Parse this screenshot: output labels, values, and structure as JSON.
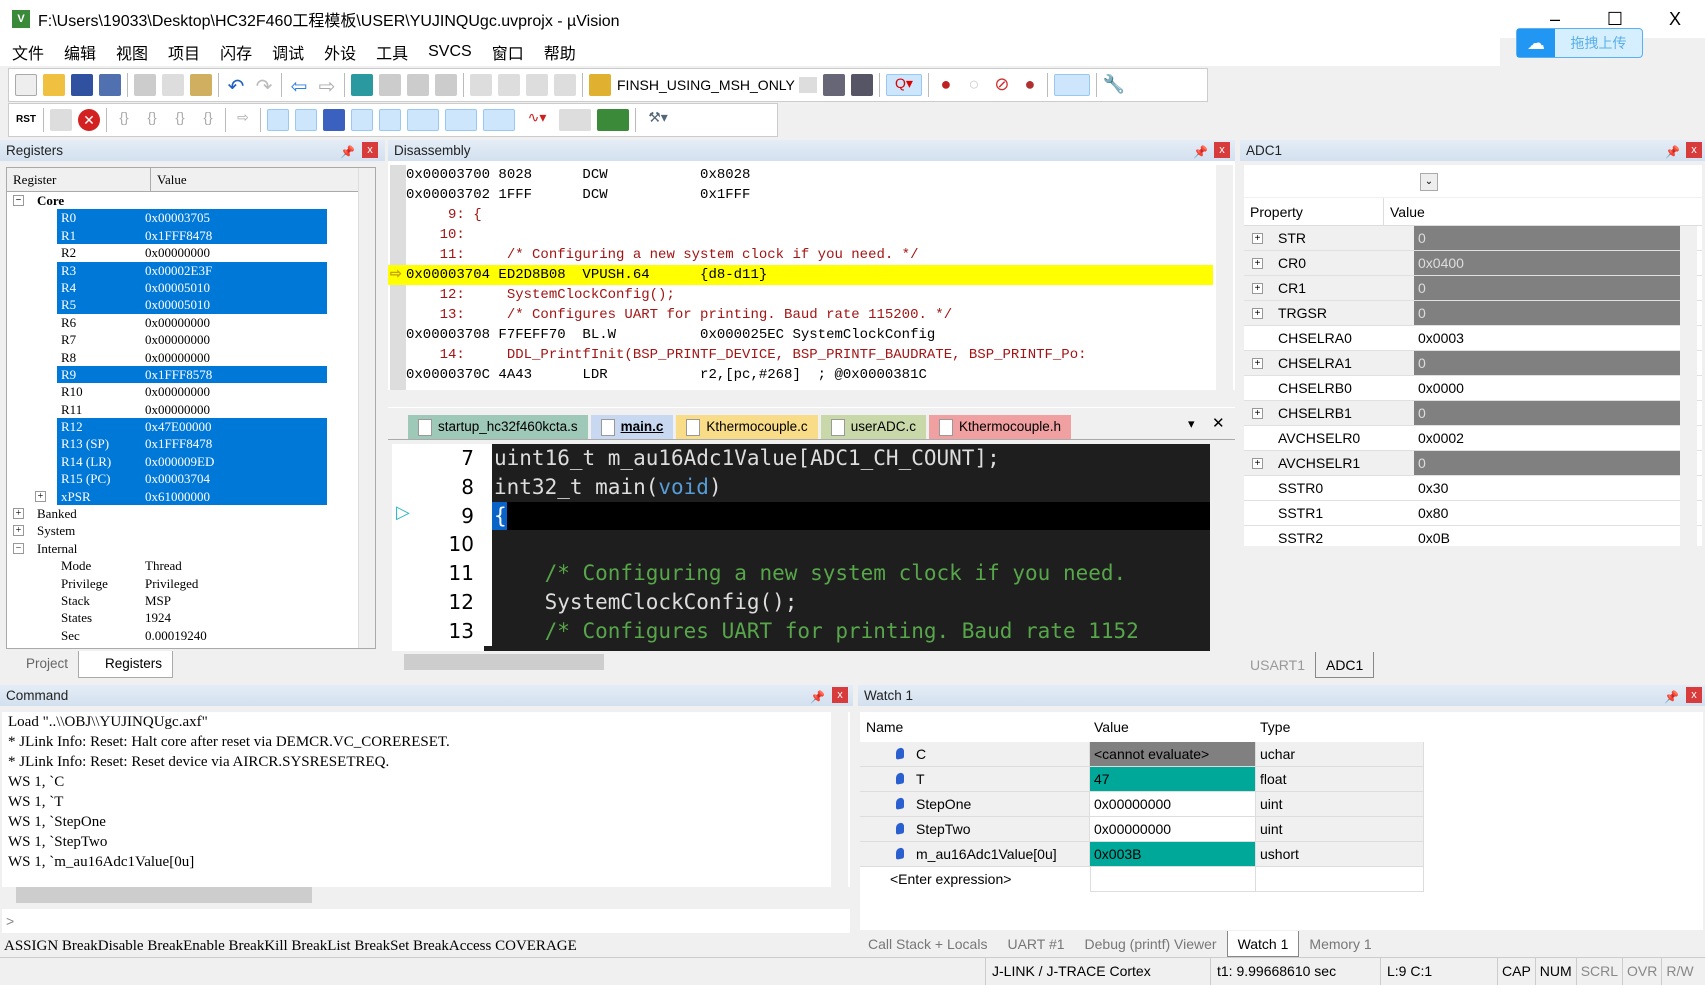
{
  "window": {
    "title": "F:\\Users\\19033\\Desktop\\HC32F460工程模板\\USER\\YUJINQUgc.uvprojx - µVision",
    "upload_label": "拖拽上传",
    "minimize": "–",
    "maximize": "☐",
    "close": "X"
  },
  "menu": [
    "文件",
    "编辑",
    "视图",
    "项目",
    "闪存",
    "调试",
    "外设",
    "工具",
    "SVCS",
    "窗口",
    "帮助"
  ],
  "toolbar": {
    "target_select": "FINSH_USING_MSH_ONLY",
    "rst_label": "RST"
  },
  "registers": {
    "title": "Registers",
    "col_register": "Register",
    "col_value": "Value",
    "groups": {
      "core": "Core",
      "banked": "Banked",
      "system": "System",
      "internal": "Internal"
    },
    "core": [
      {
        "name": "R0",
        "value": "0x00003705",
        "changed": true
      },
      {
        "name": "R1",
        "value": "0x1FFF8478",
        "changed": true
      },
      {
        "name": "R2",
        "value": "0x00000000",
        "changed": false
      },
      {
        "name": "R3",
        "value": "0x00002E3F",
        "changed": true
      },
      {
        "name": "R4",
        "value": "0x00005010",
        "changed": true
      },
      {
        "name": "R5",
        "value": "0x00005010",
        "changed": true
      },
      {
        "name": "R6",
        "value": "0x00000000",
        "changed": false
      },
      {
        "name": "R7",
        "value": "0x00000000",
        "changed": false
      },
      {
        "name": "R8",
        "value": "0x00000000",
        "changed": false
      },
      {
        "name": "R9",
        "value": "0x1FFF8578",
        "changed": true
      },
      {
        "name": "R10",
        "value": "0x00000000",
        "changed": false
      },
      {
        "name": "R11",
        "value": "0x00000000",
        "changed": false
      },
      {
        "name": "R12",
        "value": "0x47E00000",
        "changed": true
      },
      {
        "name": "R13 (SP)",
        "value": "0x1FFF8478",
        "changed": true
      },
      {
        "name": "R14 (LR)",
        "value": "0x000009ED",
        "changed": true
      },
      {
        "name": "R15 (PC)",
        "value": "0x00003704",
        "changed": true
      },
      {
        "name": "xPSR",
        "value": "0x61000000",
        "changed": true
      }
    ],
    "internal": [
      {
        "name": "Mode",
        "value": "Thread"
      },
      {
        "name": "Privilege",
        "value": "Privileged"
      },
      {
        "name": "Stack",
        "value": "MSP"
      },
      {
        "name": "States",
        "value": "1924"
      },
      {
        "name": "Sec",
        "value": "0.00019240"
      }
    ],
    "tabs": [
      "Project",
      "Registers"
    ]
  },
  "disassembly": {
    "title": "Disassembly",
    "lines": [
      {
        "text": "0x00003700 8028      DCW           0x8028",
        "src": false
      },
      {
        "text": "0x00003702 1FFF      DCW           0x1FFF",
        "src": false
      },
      {
        "text": "     9: {",
        "src": true
      },
      {
        "text": "    10: ",
        "src": true
      },
      {
        "text": "    11:     /* Configuring a new system clock if you need. */",
        "src": true
      },
      {
        "text": "0x00003704 ED2D8B08  VPUSH.64      {d8-d11}",
        "src": false,
        "current": true
      },
      {
        "text": "    12:     SystemClockConfig();",
        "src": true
      },
      {
        "text": "    13:     /* Configures UART for printing. Baud rate 115200. */",
        "src": true
      },
      {
        "text": "0x00003708 F7FEFF70  BL.W          0x000025EC SystemClockConfig",
        "src": false
      },
      {
        "text": "    14:     DDL_PrintfInit(BSP_PRINTF_DEVICE, BSP_PRINTF_BAUDRATE, BSP_PRINTF_Po:",
        "src": true
      },
      {
        "text": "0x0000370C 4A43      LDR           r2,[pc,#268]  ; @0x0000381C",
        "src": false
      }
    ]
  },
  "editor": {
    "tabs": [
      {
        "label": "startup_hc32f460kcta.s",
        "color": "#9ec8b8"
      },
      {
        "label": "main.c",
        "color": "#c8d8f0",
        "active": true
      },
      {
        "label": "Kthermocouple.c",
        "color": "#f8dc88"
      },
      {
        "label": "userADC.c",
        "color": "#c8d8a8"
      },
      {
        "label": "Kthermocouple.h",
        "color": "#f0a0a0"
      }
    ],
    "lines": [
      {
        "num": "7",
        "code": "uint16_t m_au16Adc1Value[ADC1_CH_COUNT];"
      },
      {
        "num": "8",
        "code": "int32_t main(",
        "kw": "void",
        "post": ")"
      },
      {
        "num": "9",
        "code": "{",
        "current": true
      },
      {
        "num": "10",
        "code": ""
      },
      {
        "num": "11",
        "code": "    /* Configuring a new system clock if you need.",
        "comment": true
      },
      {
        "num": "12",
        "code": "    SystemClockConfig();"
      },
      {
        "num": "13",
        "code": "    /* Configures UART for printing. Baud rate 1152",
        "comment": true
      }
    ]
  },
  "adc1": {
    "title": "ADC1",
    "col_property": "Property",
    "col_value": "Value",
    "rows": [
      {
        "p": "STR",
        "v": "0",
        "expand": true
      },
      {
        "p": "CR0",
        "v": "0x0400",
        "expand": true
      },
      {
        "p": "CR1",
        "v": "0",
        "expand": true
      },
      {
        "p": "TRGSR",
        "v": "0",
        "expand": true
      },
      {
        "p": "CHSELRA0",
        "v": "0x0003",
        "expand": false
      },
      {
        "p": "CHSELRA1",
        "v": "0",
        "expand": true
      },
      {
        "p": "CHSELRB0",
        "v": "0x0000",
        "expand": false
      },
      {
        "p": "CHSELRB1",
        "v": "0",
        "expand": true
      },
      {
        "p": "AVCHSELR0",
        "v": "0x0002",
        "expand": false
      },
      {
        "p": "AVCHSELR1",
        "v": "0",
        "expand": true
      },
      {
        "p": "SSTR0",
        "v": "0x30",
        "expand": false
      },
      {
        "p": "SSTR1",
        "v": "0x80",
        "expand": false
      },
      {
        "p": "SSTR2",
        "v": "0x0B",
        "expand": false
      }
    ],
    "tabs": [
      "USART1",
      "ADC1"
    ]
  },
  "command": {
    "title": "Command",
    "lines": [
      "Load \"..\\\\OBJ\\\\YUJINQUgc.axf\"",
      "* JLink Info: Reset: Halt core after reset via DEMCR.VC_CORERESET.",
      "* JLink Info: Reset: Reset device via AIRCR.SYSRESETREQ.",
      "WS 1, `C",
      "WS 1, `T",
      "WS 1, `StepOne",
      "WS 1, `StepTwo",
      "WS 1, `m_au16Adc1Value[0u]"
    ],
    "prompt": ">",
    "hint": "ASSIGN BreakDisable BreakEnable BreakKill BreakList BreakSet BreakAccess COVERAGE"
  },
  "watch": {
    "title": "Watch 1",
    "col_name": "Name",
    "col_value": "Value",
    "col_type": "Type",
    "rows": [
      {
        "name": "C",
        "value": "<cannot evaluate>",
        "type": "uchar",
        "state": "error"
      },
      {
        "name": "T",
        "value": "47",
        "type": "float",
        "state": "changed"
      },
      {
        "name": "StepOne",
        "value": "0x00000000",
        "type": "uint",
        "state": ""
      },
      {
        "name": "StepTwo",
        "value": "0x00000000",
        "type": "uint",
        "state": ""
      },
      {
        "name": "m_au16Adc1Value[0u]",
        "value": "0x003B",
        "type": "ushort",
        "state": "changed"
      }
    ],
    "enter_expression": "<Enter expression>",
    "tabs": [
      "Call Stack + Locals",
      "UART #1",
      "Debug (printf) Viewer",
      "Watch 1",
      "Memory 1"
    ]
  },
  "statusbar": {
    "debugger": "J-LINK / J-TRACE Cortex",
    "time": "t1: 9.99668610 sec",
    "position": "L:9 C:1",
    "indicators": [
      "CAP",
      "NUM",
      "SCRL",
      "OVR",
      "R/W"
    ]
  },
  "colors": {
    "selection": "#0078d7",
    "current_line": "#ffff00",
    "changed_watch": "#00a89a",
    "error_watch": "#808080",
    "editor_bg": "#1e1e1e",
    "comment": "#57a64a",
    "keyword": "#569cd6"
  }
}
